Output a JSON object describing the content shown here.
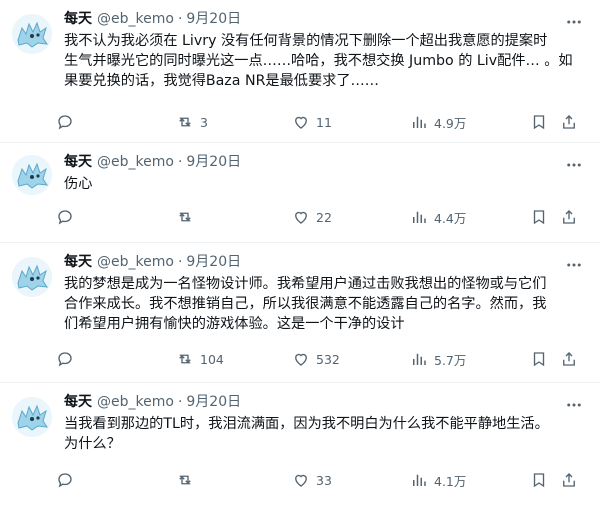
{
  "tweets": [
    {
      "name": "每天",
      "handle": "@eb_kemo",
      "dot": "·",
      "date": "9月20日",
      "text": "我不认为我必须在 Livry 没有任何背景的情况下删除一个超出我意愿的提案时\n生气并曝光它的同时曝光这一点……哈哈，我不想交换 Jumbo 的 Liv配件… 。如\n果要兑换的话，我觉得Baza NR是最低要求了……",
      "replies": "",
      "retweets": "3",
      "likes": "11",
      "views": "4.9万"
    },
    {
      "name": "每天",
      "handle": "@eb_kemo",
      "dot": "·",
      "date": "9月20日",
      "text": "伤心",
      "replies": "",
      "retweets": "",
      "likes": "22",
      "views": "4.4万"
    },
    {
      "name": "每天",
      "handle": "@eb_kemo",
      "dot": "·",
      "date": "9月20日",
      "text": "我的梦想是成为一名怪物设计师。我希望用户通过击败我想出的怪物或与它们\n合作来成长。我不想推销自己，所以我很满意不能透露自己的名字。然而，我\n们希望用户拥有愉快的游戏体验。这是一个干净的设计",
      "replies": "",
      "retweets": "104",
      "likes": "532",
      "views": "5.7万"
    },
    {
      "name": "每天",
      "handle": "@eb_kemo",
      "dot": "·",
      "date": "9月20日",
      "text": "当我看到那边的TL时，我泪流满面，因为我不明白为什么我不能平静地生活。\n为什么？",
      "replies": "",
      "retweets": "",
      "likes": "33",
      "views": "4.1万"
    }
  ],
  "icons": {
    "avatar": "blue-creature-avatar",
    "more": "more-dots-icon",
    "reply": "reply-bubble-icon",
    "retweet": "retweet-icon",
    "like": "heart-icon",
    "views": "bar-chart-icon",
    "bookmark": "bookmark-icon",
    "share": "share-icon"
  },
  "colors": {
    "text": "#0f1419",
    "secondary": "#536471",
    "divider": "#eff3f4",
    "avatar_blue": "#9ed3ea"
  }
}
